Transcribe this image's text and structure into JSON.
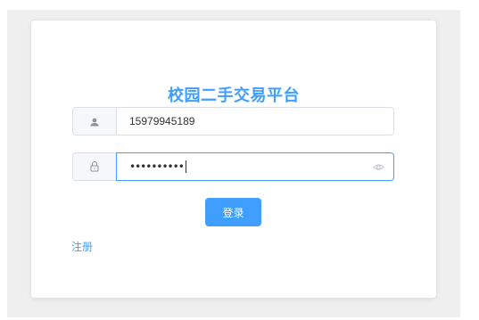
{
  "title": "校园二手交易平台",
  "username": {
    "icon": "user-icon",
    "value": "15979945189"
  },
  "password": {
    "icon": "lock-icon",
    "masked_value": "••••••••••",
    "toggle_icon": "eye-icon"
  },
  "login_button_label": "登录",
  "register_link_label": "注册",
  "colors": {
    "accent": "#409eff",
    "background": "#efefef",
    "border": "#dcdfe6"
  }
}
